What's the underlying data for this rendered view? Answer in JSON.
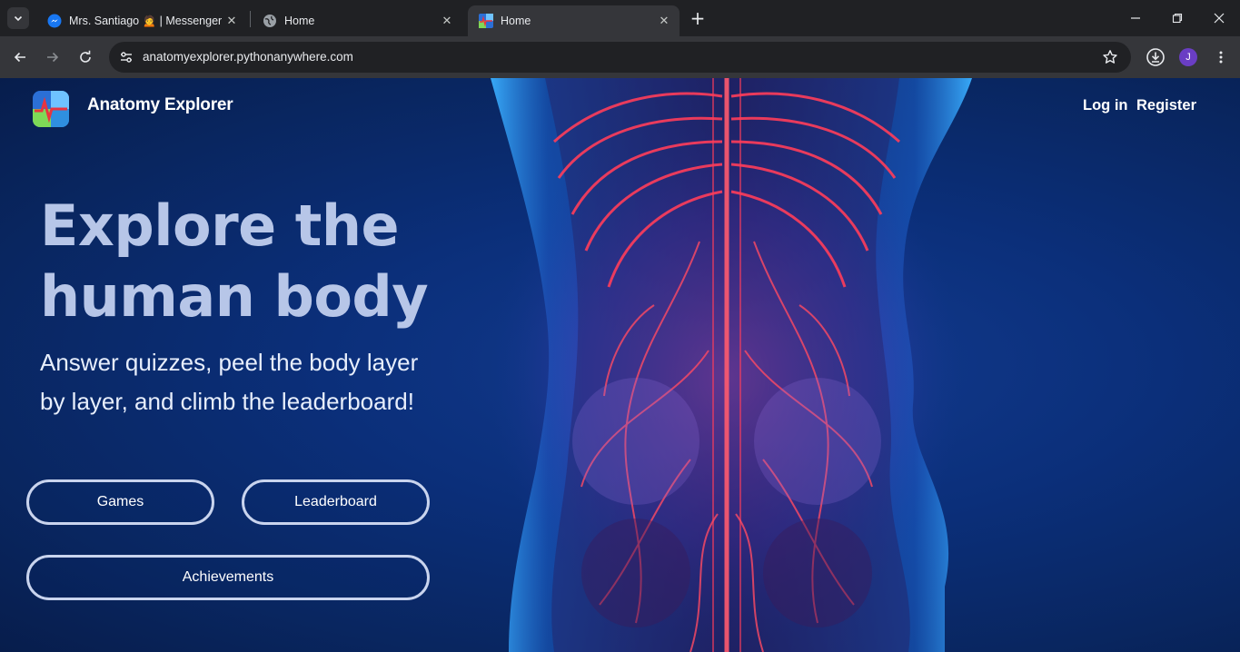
{
  "browser": {
    "tabs": [
      {
        "title": "Mrs. Santiago 🙍 | Messenger",
        "icon": "messenger-icon",
        "active": false
      },
      {
        "title": "Home",
        "icon": "globe-icon",
        "active": false
      },
      {
        "title": "Home",
        "icon": "anatomy-favicon",
        "active": true
      }
    ],
    "url": "anatomyexplorer.pythonanywhere.com",
    "profile_initial": "J",
    "accent": "#6a3ec4"
  },
  "site": {
    "brand": "Anatomy Explorer",
    "nav": {
      "login": "Log in",
      "register": "Register"
    },
    "hero": {
      "headline_line1": "Explore the",
      "headline_line2": "human body",
      "sub_line1": "Answer quizzes, peel the body layer",
      "sub_line2": "by layer, and climb the leaderboard!"
    },
    "buttons": {
      "games": "Games",
      "leaderboard": "Leaderboard",
      "achievements": "Achievements"
    },
    "colors": {
      "background": "#0b2f7a",
      "headline": "#b7c6e8",
      "vessels": "#ff3d5a",
      "body_outline": "#3aa6ff"
    }
  }
}
